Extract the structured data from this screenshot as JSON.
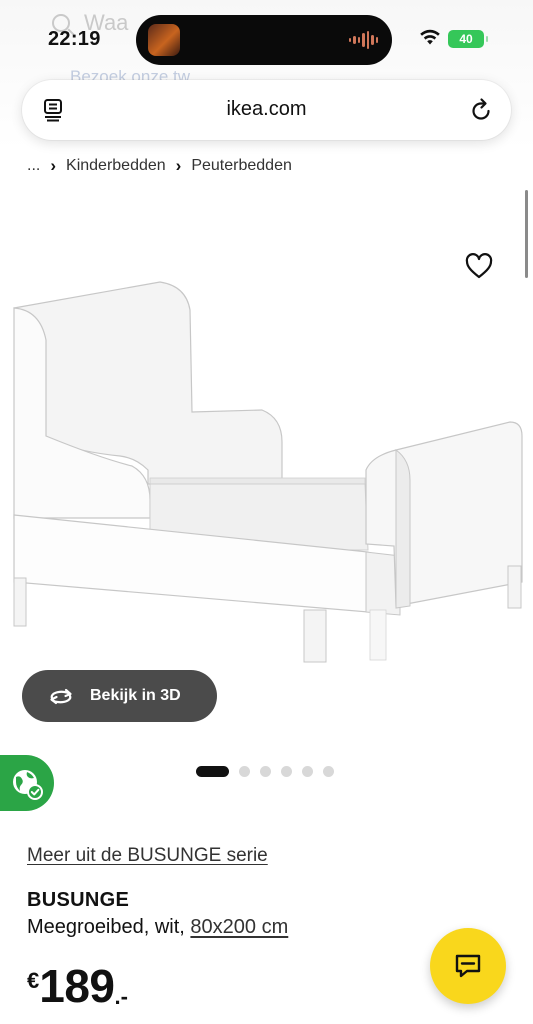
{
  "status_bar": {
    "time": "22:19",
    "battery": "40"
  },
  "background_ghost": {
    "search_partial": "Waa",
    "banner_link": "Bezoek onze tw"
  },
  "browser": {
    "url": "ikea.com"
  },
  "breadcrumb": {
    "ellipsis": "...",
    "items": [
      "Kinderbedden",
      "Peuterbedden"
    ]
  },
  "product": {
    "view_3d_label": "Bekijk in 3D",
    "series_link": "Meer uit de BUSUNGE serie",
    "name": "BUSUNGE",
    "description_prefix": "Meegroeibed, wit, ",
    "size_link": "80x200 cm",
    "price": {
      "currency": "€",
      "amount": "189",
      "suffix": ".-"
    },
    "image_count": 6,
    "active_image": 1
  },
  "colors": {
    "eco_green": "#2ba546",
    "chat_yellow": "#f9d71c",
    "button_dark": "#4b4b4b"
  }
}
